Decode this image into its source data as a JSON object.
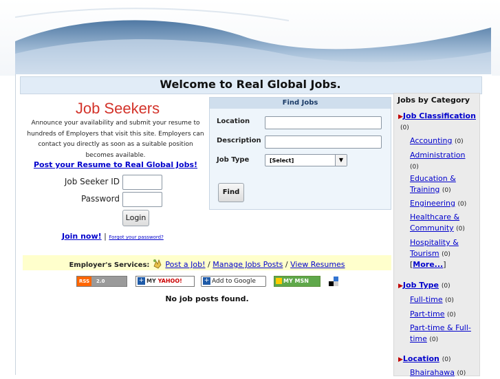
{
  "welcome": "Welcome to Real Global Jobs.",
  "job_seekers": {
    "title": "Job Seekers",
    "description": "Announce your availability and submit your resume to hundreds of Employers that visit this site. Employers can contact you directly as soon as a suitable position becomes available.",
    "post_link": "Post your Resume to Real Global Jobs!",
    "id_label": "Job Seeker ID",
    "password_label": "Password",
    "login_button": "Login",
    "join_link": "Join now!",
    "separator": "|",
    "forgot_link": "Forgot your password?"
  },
  "find_jobs": {
    "heading": "Find Jobs",
    "location_label": "Location",
    "description_label": "Description",
    "job_type_label": "Job Type",
    "job_type_selected": "[Select]",
    "find_button": "Find"
  },
  "employer": {
    "label": "Employer's Services:",
    "post_job": "Post a Job!",
    "sep1": "/",
    "manage": "Manage Jobs Posts",
    "sep2": "/",
    "view": "View Resumes"
  },
  "feeds": {
    "rss_a": "RSS",
    "rss_b": "2.0",
    "yahoo_prefix": "MY",
    "yahoo": "YAHOO!",
    "google": "Add to Google",
    "msn": "MY MSN"
  },
  "no_jobs": "No job posts found.",
  "sidebar": {
    "title": "Jobs by Category",
    "classification": "Job Classification",
    "classification_count": "(0)",
    "categories": [
      {
        "label": "Accounting",
        "count": "(0)"
      },
      {
        "label": "Administration",
        "count": "(0)"
      },
      {
        "label": "Education & Training",
        "count": "(0)"
      },
      {
        "label": "Engineering",
        "count": "(0)"
      },
      {
        "label": "Healthcare & Community",
        "count": "(0)"
      },
      {
        "label": "Hospitality & Tourism",
        "count": "(0)"
      }
    ],
    "more": "More...",
    "job_type": "Job Type",
    "job_type_count": "(0)",
    "types": [
      {
        "label": "Full-time",
        "count": "(0)"
      },
      {
        "label": "Part-time",
        "count": "(0)"
      },
      {
        "label": "Part-time & Full-time",
        "count": "(0)"
      }
    ],
    "location": "Location",
    "location_count": "(0)",
    "locations": [
      {
        "label": "Bhairahawa",
        "count": "(0)"
      }
    ]
  }
}
